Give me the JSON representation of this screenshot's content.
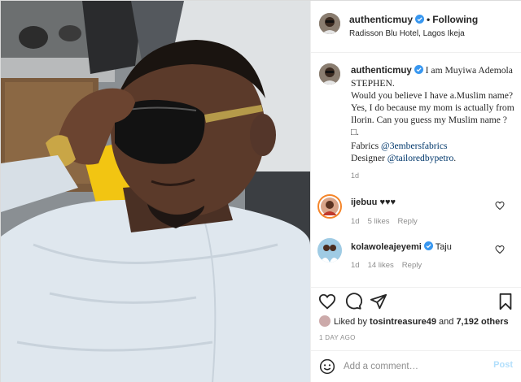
{
  "post": {
    "username": "authenticmuy",
    "following_label": "Following",
    "separator": "•",
    "location": "Radisson Blu Hotel, Lagos Ikeja"
  },
  "caption": {
    "username": "authenticmuy",
    "text": "I am Muyiwa Ademola STEPHEN.\nWould you believe I have a.Muslim name? Yes, I do because my mom is actually from Ilorin. Can you guess my Muslim name ? □.",
    "fabrics_prefix": "Fabrics ",
    "fabrics_tag": "@3embersfabrics",
    "designer_prefix": "Designer ",
    "designer_tag": "@tailoredbypetro",
    "designer_suffix": ".",
    "time": "1d"
  },
  "comments": [
    {
      "username": "ijebuu",
      "text": "♥♥♥",
      "time": "1d",
      "likes": "5 likes",
      "reply": "Reply"
    },
    {
      "username": "kolawoleajeyemi",
      "text": "Taju",
      "time": "1d",
      "likes": "14 likes",
      "reply": "Reply"
    }
  ],
  "actions": {
    "liked_by_prefix": "Liked by ",
    "liked_by_user": "tosintreasure49",
    "liked_and": " and ",
    "liked_others": "7,192 others",
    "time_ago": "1 DAY AGO"
  },
  "add_comment": {
    "placeholder": "Add a comment…",
    "post_label": "Post"
  },
  "colors": {
    "verified": "#3897f0",
    "link": "#00376b",
    "muted": "#8e8e8e",
    "post_disabled": "#b2dffc"
  },
  "icons": [
    "verified-icon",
    "heart-icon",
    "comment-icon",
    "share-icon",
    "bookmark-icon",
    "emoji-icon"
  ]
}
